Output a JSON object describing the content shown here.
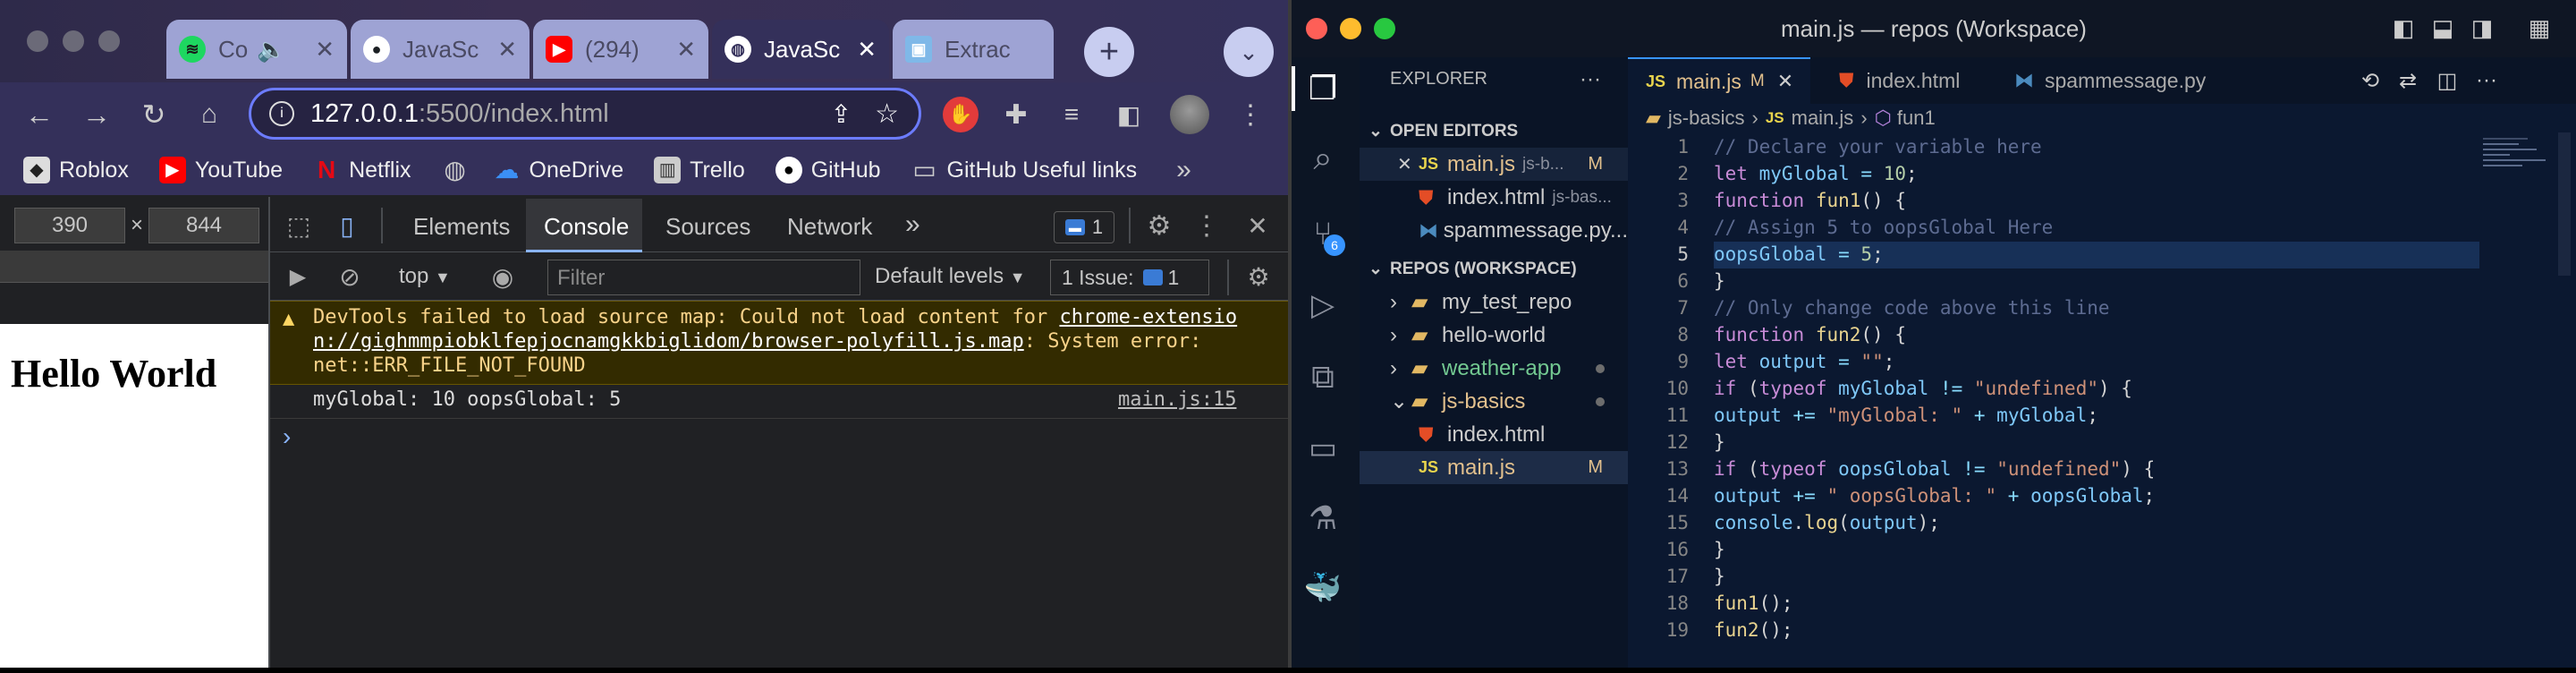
{
  "browser": {
    "tabs": [
      {
        "label": "Co",
        "icon": "spotify-icon"
      },
      {
        "label": "JavaSc",
        "icon": "github-icon"
      },
      {
        "label": "(294)",
        "icon": "youtube-icon"
      },
      {
        "label": "JavaSc",
        "icon": "globe-icon",
        "active": true
      },
      {
        "label": "Extrac",
        "icon": "extract-icon"
      }
    ],
    "url_host": "127.0.0.1",
    "url_rest": ":5500/index.html",
    "bookmarks": [
      "Roblox",
      "YouTube",
      "Netflix",
      "",
      "OneDrive",
      "Trello",
      "GitHub",
      "GitHub Useful links"
    ],
    "viewport": {
      "width": "390",
      "height": "844",
      "times": "×"
    },
    "page_heading": "Hello World"
  },
  "devtools": {
    "tabs": [
      "Elements",
      "Console",
      "Sources",
      "Network"
    ],
    "active_tab": "Console",
    "message_badge": "1",
    "context": "top",
    "filter_placeholder": "Filter",
    "levels": "Default levels",
    "issues_label": "1 Issue:",
    "issues_count": "1",
    "error_line1": "DevTools failed to load source map: Could not load content for ",
    "error_link": "chrome-extension://gighmmpiobklfepjocnamgkkbiglidom/browser-polyfill.js.map",
    "error_link_a": "chrome-extensio",
    "error_link_b": "n://gighmmpiobklfepjocnamgkkbiglidom/browser-polyfill.js.map",
    "error_after": ": System error:",
    "error_line3": "net::ERR_FILE_NOT_FOUND",
    "log_text": "myGlobal: 10 oopsGlobal: 5",
    "log_source": "main.js:15",
    "prompt": "›"
  },
  "vscode": {
    "window_title": "main.js — repos (Workspace)",
    "explorer_title": "EXPLORER",
    "open_editors_title": "OPEN EDITORS",
    "open_editors": [
      {
        "name": "main.js",
        "desc": "js-b...",
        "badge": "M",
        "type": "js"
      },
      {
        "name": "index.html",
        "desc": "js-bas...",
        "badge": "",
        "type": "html"
      },
      {
        "name": "spammessage.py...",
        "desc": "",
        "badge": "",
        "type": "py"
      }
    ],
    "workspace_title": "REPOS (WORKSPACE)",
    "folders": [
      "my_test_repo",
      "hello-world",
      "weather-app",
      "js-basics"
    ],
    "files": [
      {
        "name": "index.html",
        "type": "html",
        "badge": ""
      },
      {
        "name": "main.js",
        "type": "js",
        "badge": "M"
      }
    ],
    "editor_tabs": [
      {
        "name": "main.js",
        "badge": "M",
        "type": "js",
        "active": true
      },
      {
        "name": "index.html",
        "badge": "",
        "type": "html"
      },
      {
        "name": "spammessage.py",
        "badge": "",
        "type": "py"
      }
    ],
    "breadcrumb": [
      "js-basics",
      "main.js",
      "fun1"
    ],
    "scm_badge": "6",
    "code_lines": [
      "// Declare your variable here",
      "let myGlobal = 10;",
      "function fun1() {",
      "// Assign 5 to oopsGlobal Here",
      "oopsGlobal = 5;",
      "}",
      "// Only change code above this line",
      "function fun2() {",
      "let output = \"\";",
      "if (typeof myGlobal != \"undefined\") {",
      "output += \"myGlobal: \" + myGlobal;",
      "}",
      "if (typeof oopsGlobal != \"undefined\") {",
      "output += \" oopsGlobal: \" + oopsGlobal;",
      "console.log(output);",
      "}",
      "}",
      "fun1();",
      "fun2();"
    ]
  }
}
